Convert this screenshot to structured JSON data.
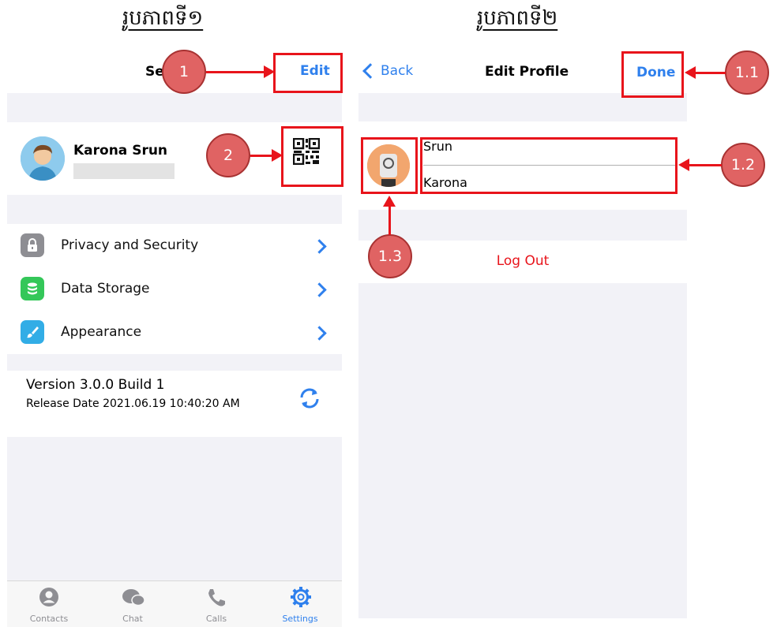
{
  "captions": {
    "left": "រូបភាពទី១",
    "right": "រូបភាពទី២"
  },
  "screen1": {
    "title_partial": "Se",
    "edit_label": "Edit",
    "profile": {
      "name": "Karona Srun"
    },
    "settings_items": [
      {
        "label": "Privacy and Security",
        "icon": "lock-icon",
        "color": "#8e8e93"
      },
      {
        "label": "Data Storage",
        "icon": "database-icon",
        "color": "#34c759"
      },
      {
        "label": "Appearance",
        "icon": "brush-icon",
        "color": "#32ade6"
      }
    ],
    "version": "Version 3.0.0 Build 1",
    "release_date": "Release Date 2021.06.19 10:40:20 AM",
    "tabs": [
      {
        "label": "Contacts",
        "icon": "person-icon",
        "active": false
      },
      {
        "label": "Chat",
        "icon": "chat-bubbles-icon",
        "active": false
      },
      {
        "label": "Calls",
        "icon": "phone-icon",
        "active": false
      },
      {
        "label": "Settings",
        "icon": "gear-icon",
        "active": true
      }
    ],
    "accent_color": "#2f80ed"
  },
  "screen2": {
    "back_label": "Back",
    "title": "Edit Profile",
    "done_label": "Done",
    "first_name": "Srun",
    "last_name": "Karona",
    "logout_label": "Log Out",
    "logout_color": "#e8141b"
  },
  "annotations": {
    "edit": "1",
    "qr": "2",
    "done": "1.1",
    "names": "1.2",
    "avatar": "1.3"
  }
}
